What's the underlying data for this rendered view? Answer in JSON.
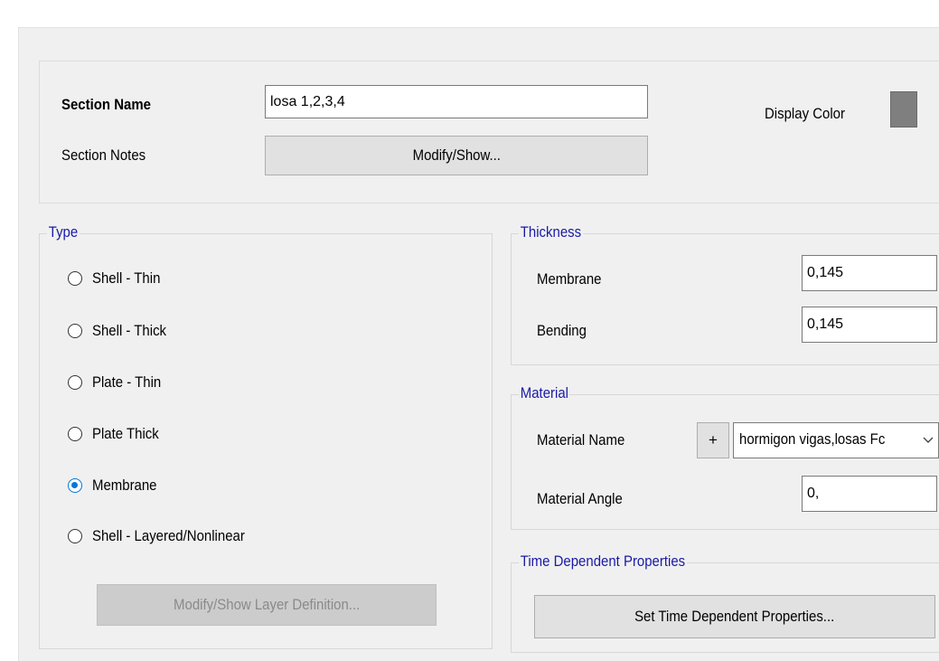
{
  "section": {
    "name_label": "Section Name",
    "name_value": "losa 1,2,3,4",
    "notes_label": "Section Notes",
    "notes_button": "Modify/Show...",
    "display_color_label": "Display Color",
    "display_color": "#7f7f7f"
  },
  "type": {
    "legend": "Type",
    "options": [
      "Shell - Thin",
      "Shell - Thick",
      "Plate - Thin",
      "Plate Thick",
      "Membrane",
      "Shell - Layered/Nonlinear"
    ],
    "selected": "Membrane",
    "layer_button": "Modify/Show Layer Definition..."
  },
  "thickness": {
    "legend": "Thickness",
    "membrane_label": "Membrane",
    "membrane_value": "0,145",
    "bending_label": "Bending",
    "bending_value": "0,145"
  },
  "material": {
    "legend": "Material",
    "name_label": "Material Name",
    "add_button": "+",
    "name_value": "hormigon vigas,losas Fc",
    "angle_label": "Material Angle",
    "angle_value": "0,"
  },
  "time_dependent": {
    "legend": "Time Dependent Properties",
    "button": "Set Time Dependent Properties..."
  },
  "icons": {
    "dropdown": "chevron-down-icon"
  }
}
